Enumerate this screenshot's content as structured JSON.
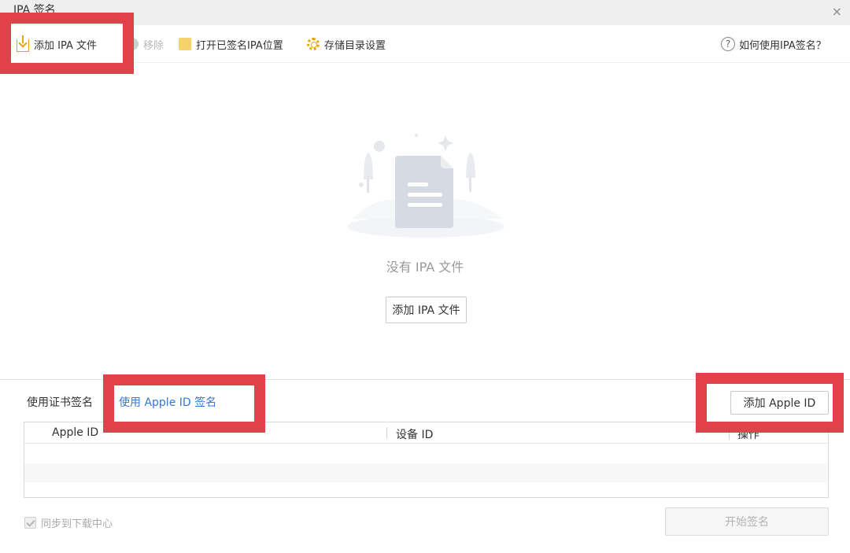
{
  "window": {
    "title": "IPA 签名",
    "close_glyph": "×"
  },
  "toolbar": {
    "add_ipa": {
      "label": "添加 IPA 文件",
      "icon": "add-file-icon"
    },
    "remove": {
      "label": "移除",
      "icon": "remove-icon",
      "disabled": true
    },
    "open_signed": {
      "label": "打开已签名IPA位置",
      "icon": "folder-icon"
    },
    "storage_settings": {
      "label": "存储目录设置",
      "icon": "gear-icon"
    },
    "help": {
      "label": "如何使用IPA签名？",
      "icon_glyph": "?"
    }
  },
  "empty_state": {
    "message": "没有 IPA 文件",
    "add_button": "添加 IPA 文件"
  },
  "signing": {
    "tabs": [
      {
        "label": "使用证书签名",
        "active": false
      },
      {
        "label": "使用 Apple ID 签名",
        "active": true
      }
    ],
    "add_apple_id_button": "添加 Apple ID",
    "table": {
      "columns": [
        "Apple ID",
        "设备 ID",
        "操作"
      ],
      "rows": []
    },
    "sync_checkbox": {
      "label": "同步到下载中心",
      "checked": true,
      "disabled": true
    },
    "start_button": {
      "label": "开始签名",
      "disabled": true
    }
  },
  "colors": {
    "accent": "#3477d7",
    "highlight": "#e0414b",
    "icon_orange": "#e8a500"
  }
}
